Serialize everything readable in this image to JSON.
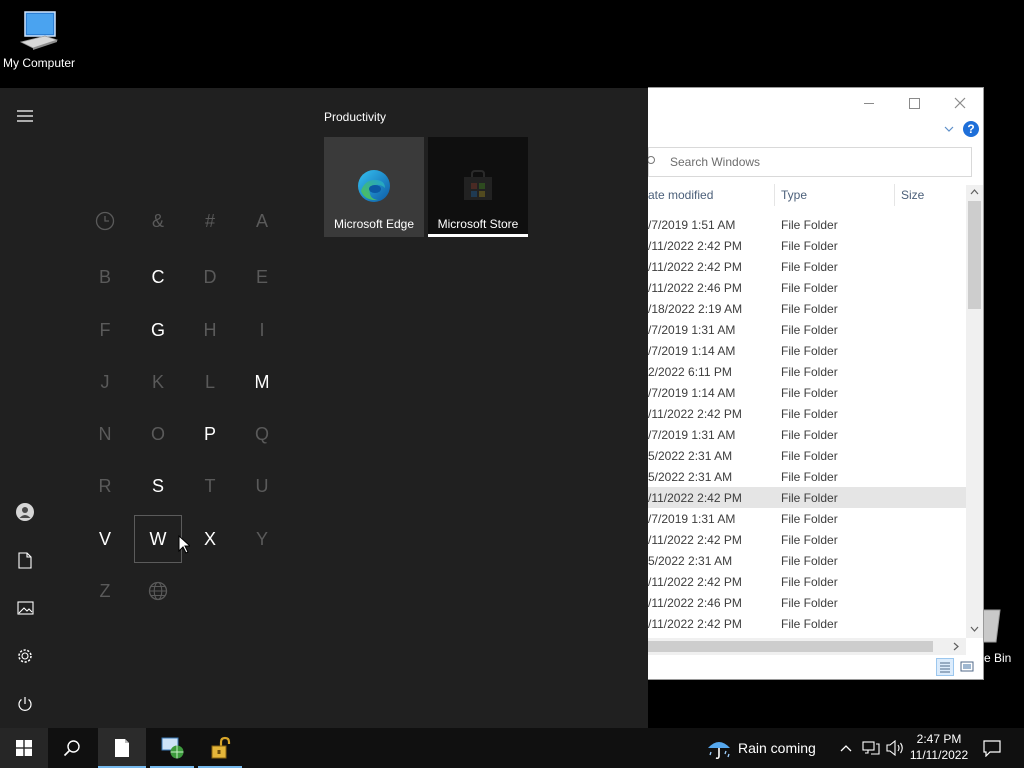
{
  "desktop": {
    "my_computer_label": "My Computer",
    "recycle_bin_label": "e Bin"
  },
  "explorer": {
    "search_placeholder": "Search Windows",
    "help_label": "?",
    "columns": {
      "date": "ate modified",
      "type": "Type",
      "size": "Size"
    },
    "rows": [
      {
        "date": "/7/2019 1:51 AM",
        "type": "File Folder"
      },
      {
        "date": "/11/2022 2:42 PM",
        "type": "File Folder"
      },
      {
        "date": "/11/2022 2:42 PM",
        "type": "File Folder"
      },
      {
        "date": "/11/2022 2:46 PM",
        "type": "File Folder"
      },
      {
        "date": "/18/2022 2:19 AM",
        "type": "File Folder"
      },
      {
        "date": "/7/2019 1:31 AM",
        "type": "File Folder"
      },
      {
        "date": "/7/2019 1:14 AM",
        "type": "File Folder"
      },
      {
        "date": "2/2022 6:11 PM",
        "type": "File Folder"
      },
      {
        "date": "/7/2019 1:14 AM",
        "type": "File Folder"
      },
      {
        "date": "/11/2022 2:42 PM",
        "type": "File Folder"
      },
      {
        "date": "/7/2019 1:31 AM",
        "type": "File Folder"
      },
      {
        "date": "5/2022 2:31 AM",
        "type": "File Folder"
      },
      {
        "date": "5/2022 2:31 AM",
        "type": "File Folder"
      },
      {
        "date": "/11/2022 2:42 PM",
        "type": "File Folder"
      },
      {
        "date": "/7/2019 1:31 AM",
        "type": "File Folder"
      },
      {
        "date": "/11/2022 2:42 PM",
        "type": "File Folder"
      },
      {
        "date": "5/2022 2:31 AM",
        "type": "File Folder"
      },
      {
        "date": "/11/2022 2:42 PM",
        "type": "File Folder"
      },
      {
        "date": "/11/2022 2:46 PM",
        "type": "File Folder"
      },
      {
        "date": "/11/2022 2:42 PM",
        "type": "File Folder"
      }
    ],
    "selected_row": 13
  },
  "start_menu": {
    "group_title": "Productivity",
    "tiles": [
      {
        "name": "Microsoft Edge"
      },
      {
        "name": "Microsoft Store"
      }
    ],
    "letters": [
      {
        "label": "clock",
        "active": false,
        "icon": "clock-icon"
      },
      {
        "label": "&",
        "active": false
      },
      {
        "label": "#",
        "active": false
      },
      {
        "label": "A",
        "active": false
      },
      {
        "label": "B",
        "active": false
      },
      {
        "label": "C",
        "active": true
      },
      {
        "label": "D",
        "active": false
      },
      {
        "label": "E",
        "active": false
      },
      {
        "label": "F",
        "active": false
      },
      {
        "label": "G",
        "active": true
      },
      {
        "label": "H",
        "active": false
      },
      {
        "label": "I",
        "active": false
      },
      {
        "label": "J",
        "active": false
      },
      {
        "label": "K",
        "active": false
      },
      {
        "label": "L",
        "active": false
      },
      {
        "label": "M",
        "active": true
      },
      {
        "label": "N",
        "active": false
      },
      {
        "label": "O",
        "active": false
      },
      {
        "label": "P",
        "active": true
      },
      {
        "label": "Q",
        "active": false
      },
      {
        "label": "R",
        "active": false
      },
      {
        "label": "S",
        "active": true
      },
      {
        "label": "T",
        "active": false
      },
      {
        "label": "U",
        "active": false
      },
      {
        "label": "V",
        "active": true
      },
      {
        "label": "W",
        "active": true,
        "focused": true
      },
      {
        "label": "X",
        "active": true
      },
      {
        "label": "Y",
        "active": false
      },
      {
        "label": "Z",
        "active": false
      },
      {
        "label": "globe",
        "active": false,
        "icon": "globe-icon"
      }
    ]
  },
  "taskbar": {
    "weather_text": "Rain coming",
    "time": "2:47 PM",
    "date": "11/11/2022"
  },
  "colors": {
    "start_bg": "#202020",
    "taskbar_bg": "#101010",
    "accent": "#76b9ed",
    "help_blue": "#1e6fd9"
  }
}
